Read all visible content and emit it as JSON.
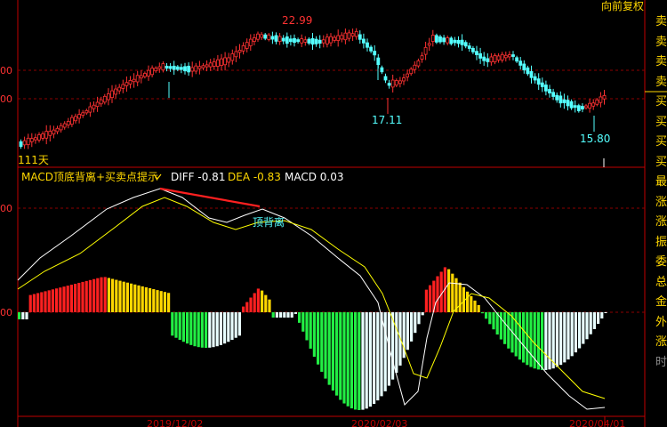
{
  "header": {
    "mode_label": "向前复权"
  },
  "price_panel": {
    "high_label": "22.99",
    "low_label_1": "17.11",
    "low_label_2": "15.80",
    "days_label": "111天",
    "y_labels": [
      "00",
      "00"
    ]
  },
  "macd_panel": {
    "indicator_name": "MACD顶底背离+买卖点提示",
    "diff_text": "DIFF -0.81",
    "dea_text": "DEA -0.83",
    "macd_text": "MACD 0.03",
    "divergence_label": "顶背离",
    "y_labels": [
      "00",
      "00"
    ]
  },
  "x_axis": {
    "dates": [
      "2019/12/02",
      "2020/02/03",
      "2020/04/01"
    ]
  },
  "side_panel": {
    "items": [
      "卖",
      "卖",
      "卖",
      "卖",
      "买",
      "买",
      "买",
      "买",
      "最",
      "涨",
      "涨",
      "振",
      "委",
      "总",
      "金",
      "外",
      "涨",
      "时"
    ]
  },
  "colors": {
    "up": "#ff3232",
    "down": "#54ffff",
    "macd_up": "#ff2020",
    "macd_up_weak": "#ffd700",
    "macd_down": "#22ee44",
    "macd_down_weak": "#e8ffff",
    "dashed_grid": "#8b0000",
    "axis": "#c00000",
    "yellow_text": "#ffd700",
    "diff_line": "#ffffff",
    "dea_line": "#ffff00"
  }
}
